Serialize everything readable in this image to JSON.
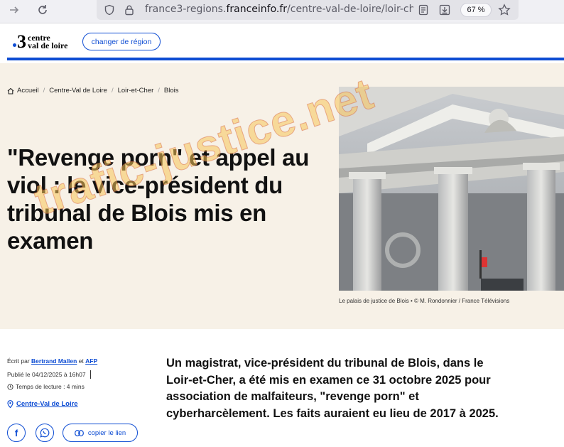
{
  "browser": {
    "url_prefix": "france3-regions.",
    "url_domain": "franceinfo.fr",
    "url_path": "/centre-val-de-loire/loir-cher/blois",
    "zoom": "67 %"
  },
  "site": {
    "logo_number": "3",
    "logo_line1": "centre",
    "logo_line2": "val de loire",
    "region_button": "changer de région",
    "accent_color": "#0d4cd3"
  },
  "breadcrumb": [
    "Accueil",
    "Centre-Val de Loire",
    "Loir-et-Cher",
    "Blois"
  ],
  "article": {
    "title": "\"Revenge porn\" et appel au viol : le vice-président du tribunal de Blois mis en examen",
    "image_caption": "Le palais de justice de Blois • © M. Rondonnier / France Télévisions",
    "written_by": "Écrit par",
    "author": "Bertrand Mallen",
    "and": "et",
    "agency": "AFP",
    "published": "Publié le 04/12/2025 à 16h07",
    "reading_time": "Temps de lecture : 4 mins",
    "region_tag": "Centre-Val de Loire",
    "copy_link": "copier le lien",
    "lead": "Un magistrat, vice-président du tribunal de Blois, dans le Loir-et-Cher, a été mis en examen ce 31 octobre 2025 pour association de malfaiteurs, \"revenge porn\" et cyberharcèlement. Les faits auraient eu lieu de 2017 à 2025."
  },
  "watermark": "trafic-justice.net"
}
